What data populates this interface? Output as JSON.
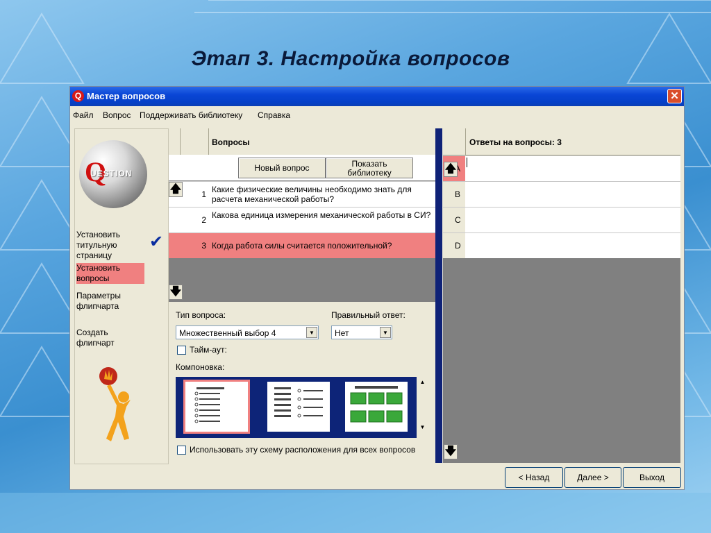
{
  "slide_title": "Этап 3. Настройка вопросов",
  "window": {
    "title": "Мастер вопросов",
    "icon_letter": "Q",
    "close_glyph": "✕"
  },
  "menu": [
    "Файл",
    "Вопрос",
    "Поддерживать библиотеку",
    "Справка"
  ],
  "logo_text": "UESTION",
  "steps": [
    {
      "label": "Установить титульную страницу",
      "lines": [
        "Установить",
        "титульную",
        "страницу"
      ],
      "done": true
    },
    {
      "label": "Установить вопросы",
      "lines": [
        "Установить",
        "вопросы"
      ],
      "active": true
    },
    {
      "label": "Параметры флипчарта",
      "lines": [
        "Параметры",
        "флипчарта"
      ]
    },
    {
      "label": "Создать флипчарт",
      "lines": [
        "Создать",
        "флипчарт"
      ]
    }
  ],
  "questions": {
    "header": "Вопросы",
    "new_button": "Новый вопрос",
    "library_button": [
      "Показать",
      "библиотеку"
    ],
    "rows": [
      {
        "num": "1",
        "text": "Какие физические величины необходимо знать для расчета механической работы?"
      },
      {
        "num": "2",
        "text": "Какова единица измерения  механической работы в СИ?"
      },
      {
        "num": "3",
        "text": "Когда работа силы считается положительной?",
        "selected": true
      }
    ]
  },
  "settings": {
    "type_label": "Тип вопроса:",
    "type_value": "Множественный выбор 4",
    "correct_label": "Правильный ответ:",
    "correct_value": "Нет",
    "timeout_label": "Тайм-аут:",
    "layout_label": "Компоновка:",
    "use_all_label": "Использовать эту схему расположения для всех вопросов"
  },
  "answers": {
    "header": "Ответы на вопросы: 3",
    "letters": [
      "A",
      "B",
      "C",
      "D"
    ]
  },
  "footer": {
    "back": "< Назад",
    "next": "Далее >",
    "exit": "Выход"
  },
  "colors": {
    "selection": "#f08080",
    "titlebar": "#0a46d6",
    "divider": "#0f2277"
  }
}
